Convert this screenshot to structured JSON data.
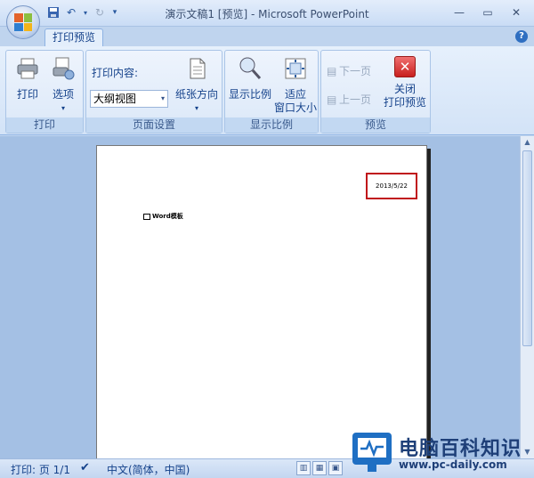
{
  "window": {
    "title": "演示文稿1 [预览] - Microsoft PowerPoint",
    "controls": [
      "—",
      "▭",
      "✕"
    ]
  },
  "tabs": {
    "active": "打印预览"
  },
  "ribbon": {
    "print_group": {
      "label": "打印",
      "print_btn": "打印",
      "options_btn": "选项"
    },
    "page_setup_group": {
      "label": "页面设置",
      "content_label": "打印内容:",
      "content_value": "大纲视图",
      "orientation_btn": "纸张方向"
    },
    "zoom_group": {
      "label": "显示比例",
      "zoom_btn": "显示比例",
      "fit_btn_line1": "适应",
      "fit_btn_line2": "窗口大小"
    },
    "preview_group": {
      "label": "预览",
      "next_btn": "下一页",
      "prev_btn": "上一页",
      "close_line1": "关闭",
      "close_line2": "打印预览"
    }
  },
  "page": {
    "date": "2013/5/22",
    "body_text": "Word模板"
  },
  "status": {
    "page": "打印: 页 1/1",
    "language": "中文(简体，中国)"
  },
  "watermark": {
    "text": "电脑百科知识",
    "url": "www.pc-daily.com"
  }
}
